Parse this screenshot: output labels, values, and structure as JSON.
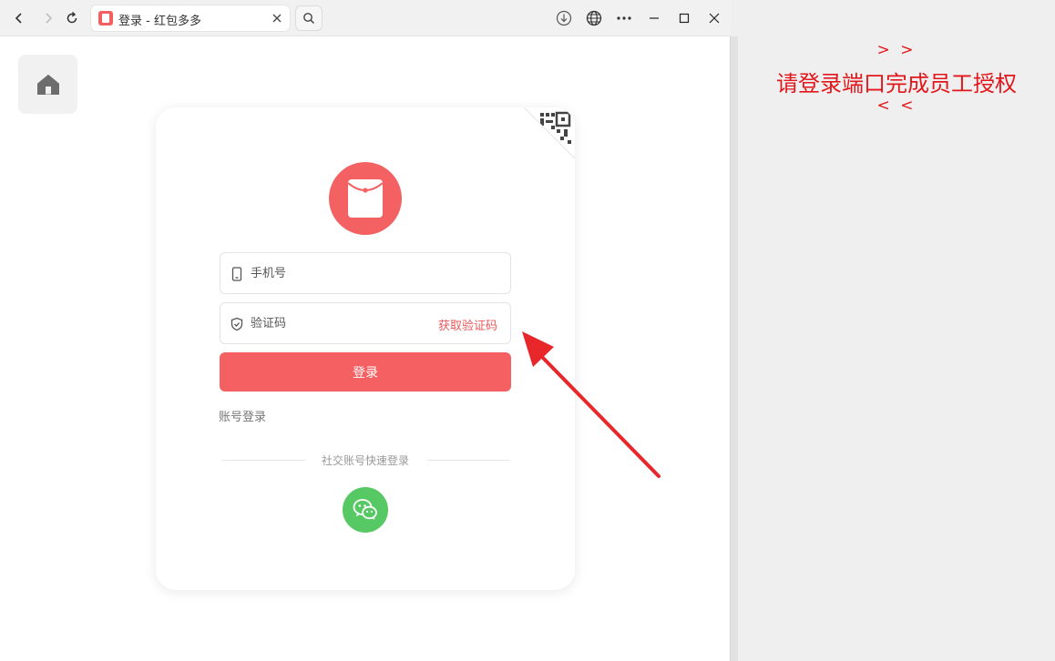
{
  "browser": {
    "tab": {
      "title": "登录 - 红包多多"
    },
    "icons": {
      "back": "chevron-left-icon",
      "forward": "chevron-right-icon",
      "reload": "reload-icon",
      "search": "search-icon",
      "download": "download-icon",
      "translate": "globe-icon",
      "more": "more-icon",
      "minimize": "minimize-icon",
      "maximize": "maximize-icon",
      "close": "close-icon"
    }
  },
  "login": {
    "phone_placeholder": "手机号",
    "code_placeholder": "验证码",
    "get_code_label": "获取验证码",
    "submit_label": "登录",
    "account_login_label": "账号登录",
    "social_label": "社交账号快速登录"
  },
  "annotation": {
    "arrows_top": "> >",
    "instruction": "请登录端口完成员工授权",
    "arrows_bottom": "< <"
  },
  "colors": {
    "brand": "#f36162",
    "wechat": "#57c964",
    "annotation": "#e2161b"
  }
}
